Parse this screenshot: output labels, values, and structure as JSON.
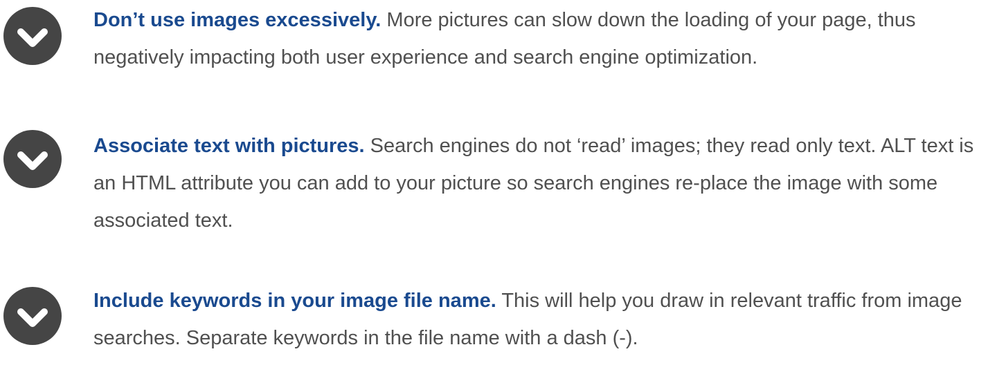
{
  "colors": {
    "heading": "#1a4a8f",
    "body_text": "#505050",
    "icon_circle": "#454545",
    "icon_check": "#ffffff"
  },
  "tips": [
    {
      "icon": "chevron-down-circle-icon",
      "heading": "Don’t use images excessively.",
      "body": " More pictures can slow down the loading of your page, thus negatively impacting both user experience and search engine optimization."
    },
    {
      "icon": "chevron-down-circle-icon",
      "heading": "Associate text with pictures.",
      "body": " Search engines do not ‘read’ images; they read only text. ALT text is an HTML attribute you can add to your picture so search engines re-place the image with some associated text."
    },
    {
      "icon": "chevron-down-circle-icon",
      "heading": "Include keywords in your image file name.",
      "body": " This will help you draw in relevant traffic from image searches. Separate keywords in the file name with a dash (-)."
    }
  ]
}
